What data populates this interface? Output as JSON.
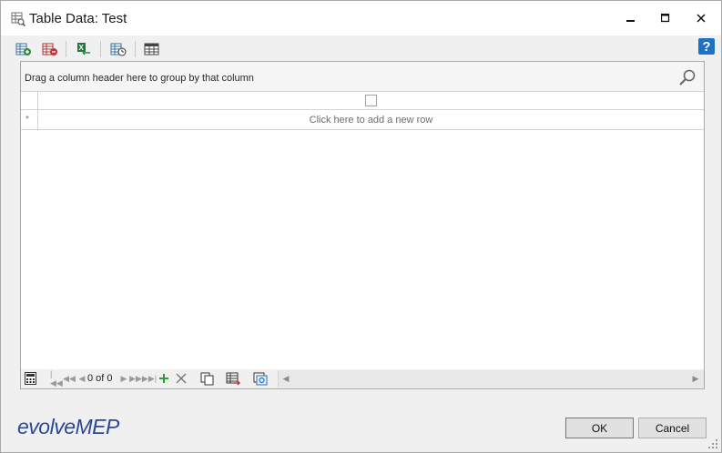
{
  "window": {
    "title": "Table Data: Test"
  },
  "toolbar": {
    "help_label": "?"
  },
  "grid": {
    "group_panel_text": "Drag a column header here to group by that column",
    "new_row_text": "Click here to add a new row",
    "new_row_marker": "*"
  },
  "navigator": {
    "record_count": "0 of 0"
  },
  "footer": {
    "logo_text": "evolveMEP",
    "ok_label": "OK",
    "cancel_label": "Cancel"
  },
  "colors": {
    "accent": "#1c72c4",
    "logo": "#2b4a92",
    "excel_green": "#1e7a3c",
    "add_green": "#2a9d38"
  }
}
